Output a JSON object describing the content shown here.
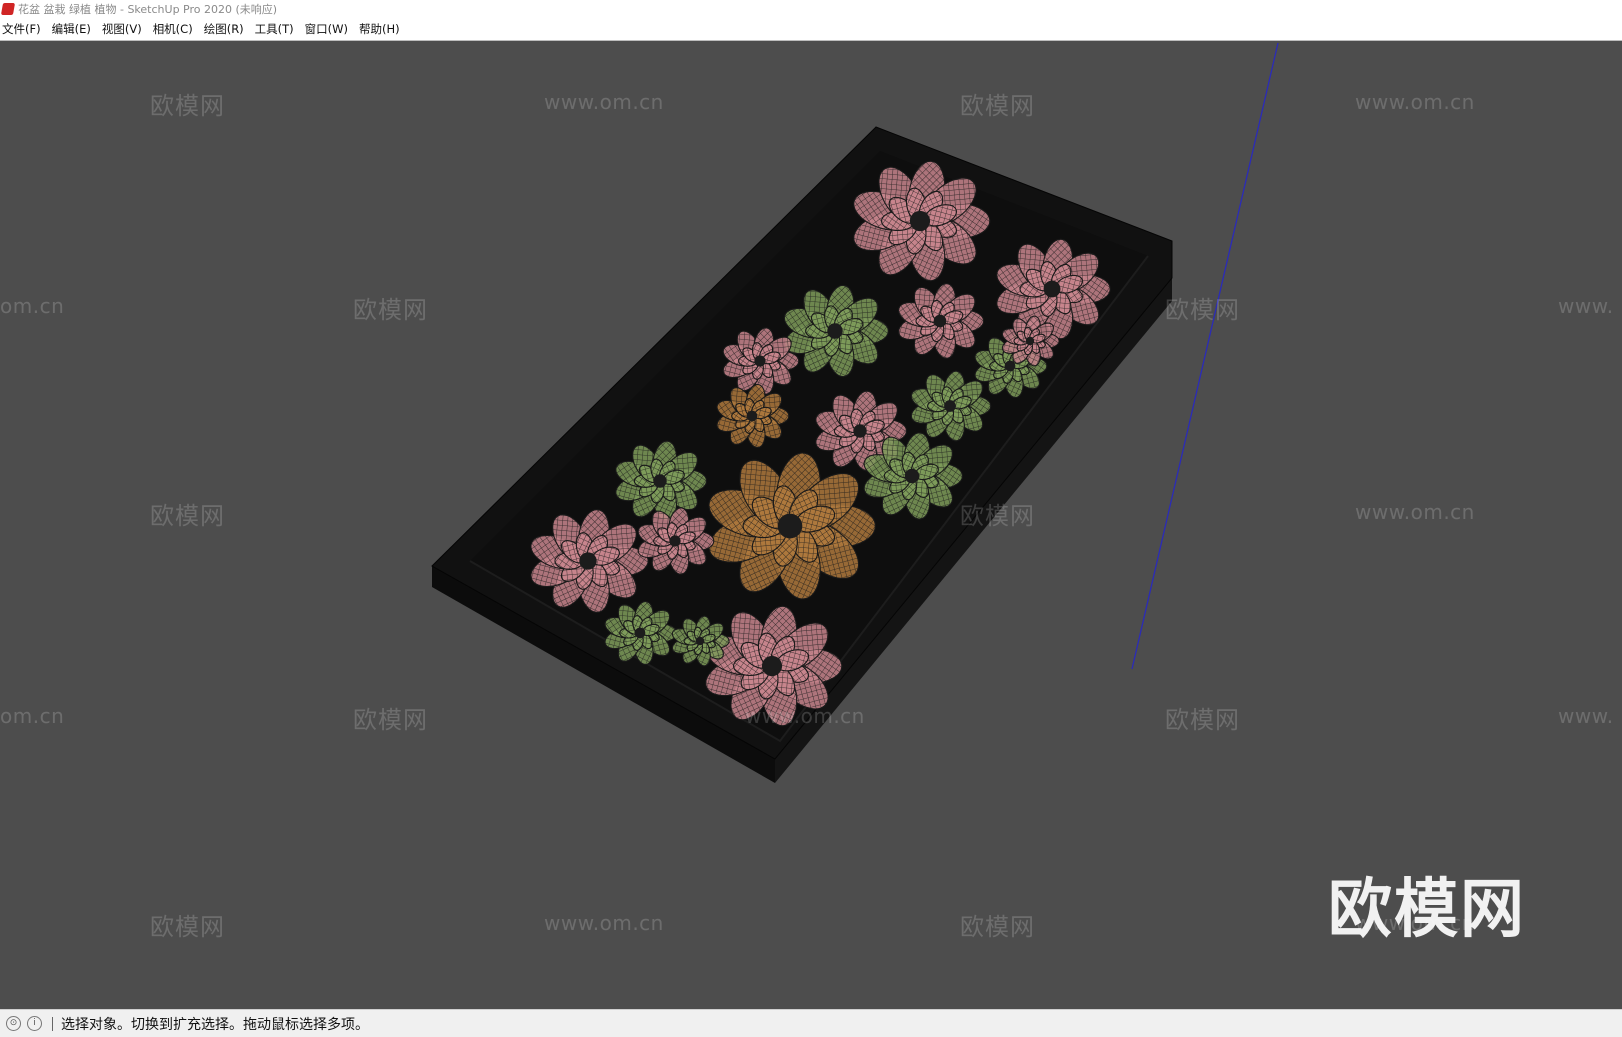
{
  "window": {
    "title": "花盆 盆栽 绿植 植物 - SketchUp Pro 2020 (未响应)"
  },
  "menu": [
    {
      "label": "文件(F)"
    },
    {
      "label": "编辑(E)"
    },
    {
      "label": "视图(V)"
    },
    {
      "label": "相机(C)"
    },
    {
      "label": "绘图(R)"
    },
    {
      "label": "工具(T)"
    },
    {
      "label": "窗口(W)"
    },
    {
      "label": "帮助(H)"
    }
  ],
  "watermarks": {
    "brand": "欧模网",
    "url": "www.om.cn",
    "url_partial_left": "om.cn",
    "url_partial_right": "www."
  },
  "status": {
    "text": "选择对象。切换到扩充选择。拖动鼠标选择多项。",
    "icons": [
      "geolocation-icon",
      "info-icon"
    ]
  },
  "colors": {
    "viewport_bg": "#4d4d4d",
    "planter": "#111111",
    "axis_blue": "#2b2bb8",
    "leaf_pink": "#c9868e",
    "leaf_green": "#7f9d5b",
    "leaf_orange": "#b07a3e"
  }
}
